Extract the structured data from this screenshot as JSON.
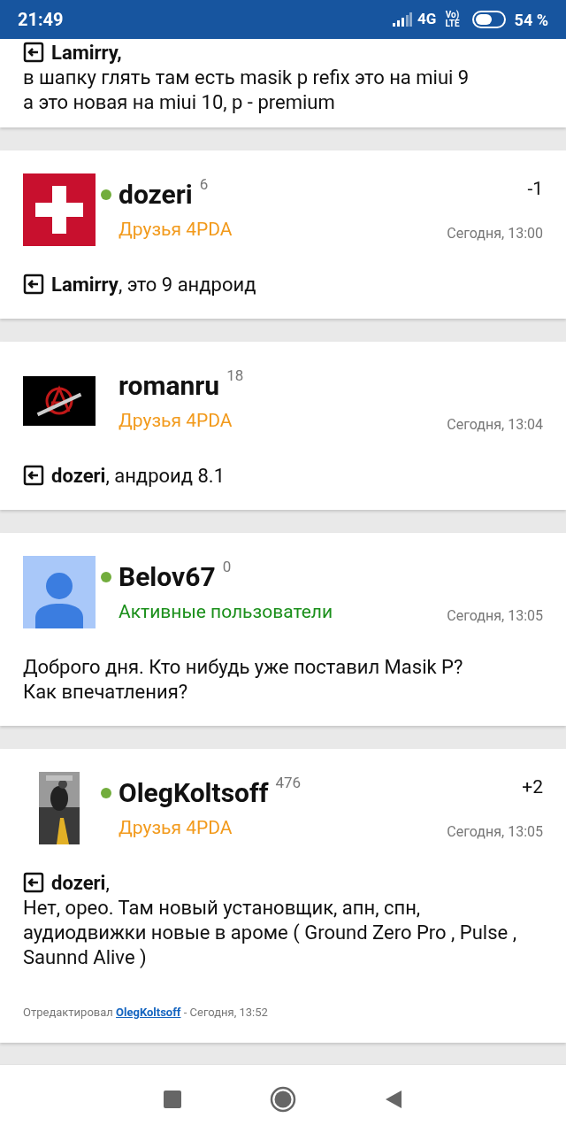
{
  "status_bar": {
    "time": "21:49",
    "network": "4G",
    "volte_top": "Vo)",
    "volte_bottom": "LTE",
    "battery": "54 %"
  },
  "posts": [
    {
      "kind": "partial",
      "reply": true,
      "text": "**Lamirry,**\nв шапку глять там есть masik p refix это на miui 9\nа это новая на miui 10, p - premium"
    },
    {
      "kind": "full",
      "avatar": {
        "kind": "flag"
      },
      "online": true,
      "author": "dozeri",
      "reputation": "6",
      "rank": "Друзья 4PDA",
      "color": "#f29a1c",
      "rating": "-1",
      "time": "Сегодня, 13:00",
      "reply": true,
      "text": "**Lamirry**, это 9 андроид"
    },
    {
      "kind": "full",
      "online": false,
      "author": "romanru",
      "reputation": "18",
      "rank": "Друзья 4PDA",
      "color": "#f29a1c",
      "time": "Сегодня, 13:04",
      "reply": true,
      "text": "**dozeri**, андроид 8.1"
    },
    {
      "kind": "full",
      "avatar": {
        "kind": "default"
      },
      "online": true,
      "author": "Belov67",
      "reputation": "0",
      "rank": "Активные пользователи",
      "color": "#1a8f1a",
      "time": "Сегодня, 13:05",
      "reply": false,
      "text": "Доброго дня. Кто нибудь уже поставил Masik P?\nКак впечатления?"
    },
    {
      "kind": "full",
      "online": true,
      "author": "OlegKoltsoff",
      "reputation": "476",
      "rank": "Друзья 4PDA",
      "color": "#f29a1c",
      "rating": "+2",
      "time": "Сегодня, 13:05",
      "reply": true,
      "text": "**dozeri**,\nНет, орео. Там новый установщик, апн, спн, аудиодвижки  новые в ароме ( Ground Zero Pro , Pulse , Saunnd Alive )",
      "edited": {
        "prefix": "Отредактировал",
        "author": "OlegKoltsoff",
        "suffix": "- Сегодня, 13:52"
      }
    }
  ]
}
